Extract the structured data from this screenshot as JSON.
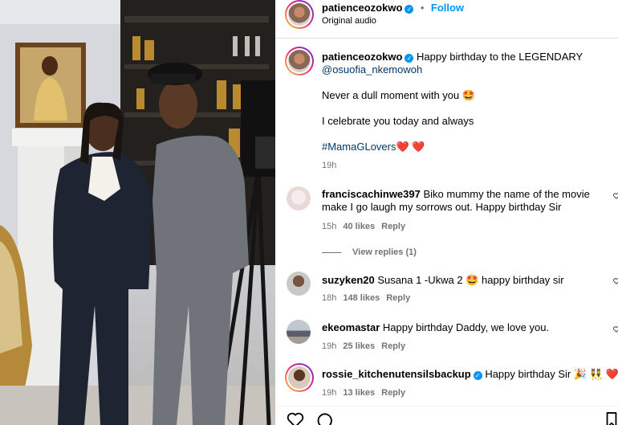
{
  "header": {
    "username": "patienceozokwo",
    "follow_label": "Follow",
    "dot": "•",
    "audio": "Original audio"
  },
  "caption": {
    "username": "patienceozokwo",
    "text": "Happy birthday to the LEGENDARY",
    "mention": "@osuofia_nkemowoh",
    "line2": "Never a dull moment with you 🤩",
    "line3": "I celebrate you today and always",
    "hashtag": "#MamaGLovers",
    "hashtag_suffix": "❤️ ❤️",
    "time": "19h"
  },
  "comments": [
    {
      "username": "franciscachinwe397",
      "text": "Biko mummy the name of the movie make I go laugh my sorrows out. Happy birthday Sir",
      "time": "15h",
      "likes": "40 likes",
      "reply": "Reply",
      "view_replies": "View replies (1)"
    },
    {
      "username": "suzyken20",
      "text": "Susana 1 -Ukwa 2 🤩 happy birthday sir",
      "time": "18h",
      "likes": "148 likes",
      "reply": "Reply"
    },
    {
      "username": "ekeomastar",
      "text": "Happy birthday Daddy, we love you.",
      "time": "19h",
      "likes": "25 likes",
      "reply": "Reply"
    },
    {
      "username": "rossie_kitchenutensilsbackup",
      "text": "Happy birthday Sir 🎉 👯 ❤️",
      "time": "19h",
      "likes": "13 likes",
      "reply": "Reply"
    }
  ],
  "colors": {
    "accent": "#0095f6",
    "verified": "#0095f6",
    "link": "#00376b",
    "muted": "#737373"
  },
  "icons": [
    "heart-icon",
    "comment-icon",
    "bookmark-icon",
    "verified-badge-icon"
  ]
}
